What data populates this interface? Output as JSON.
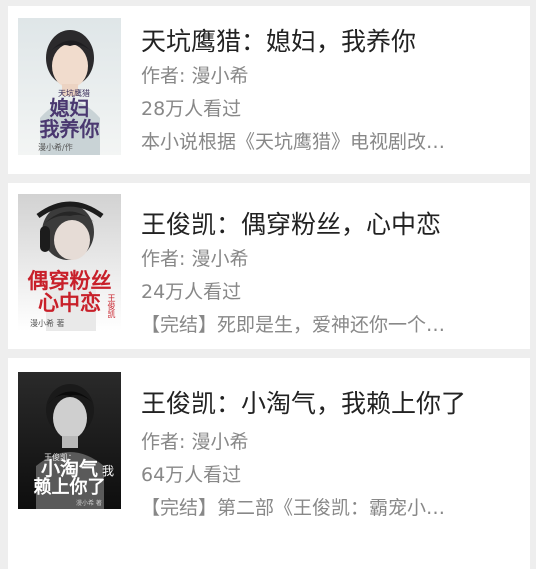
{
  "books": [
    {
      "title": "天坑鹰猎：媳妇，我养你",
      "author": "作者: 漫小希",
      "views": "28万人看过",
      "desc": "本小说根据《天坑鹰猎》电视剧改…",
      "cover_text": {
        "sub": "天坑鹰猎",
        "line1": "媳妇",
        "line2": "我养你",
        "author": "漫小希/作"
      }
    },
    {
      "title": "王俊凯：偶穿粉丝，心中恋",
      "author": "作者: 漫小希",
      "views": "24万人看过",
      "desc": "【完结】死即是生，爱神还你一个…",
      "cover_text": {
        "line1": "偶穿粉丝",
        "line2": "心中恋",
        "side": "王俊凯",
        "author": "漫小希 著"
      }
    },
    {
      "title": "王俊凯：小淘气，我赖上你了",
      "author": "作者: 漫小希",
      "views": "64万人看过",
      "desc": "【完结】第二部《王俊凯：霸宠小…",
      "cover_text": {
        "sub": "王俊凯：",
        "line1": "小淘气",
        "line2": "赖上你了",
        "side": "我",
        "author": "漫小希 著"
      }
    }
  ],
  "colors": {
    "background": "#eeeeee",
    "card": "#ffffff",
    "title": "#222222",
    "meta": "#888888",
    "cover2_title": "#c8202a"
  }
}
